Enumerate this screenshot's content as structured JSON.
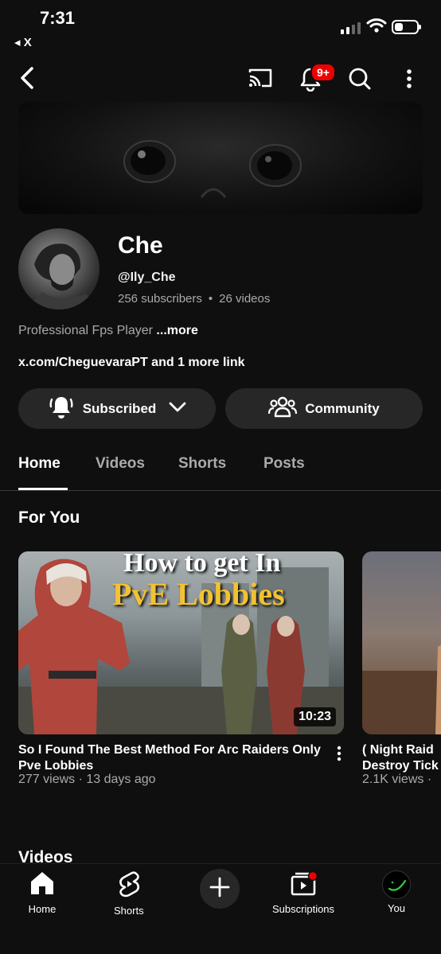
{
  "status": {
    "time": "7:31",
    "back_app": "◂ X"
  },
  "topbar": {
    "notifications_badge": "9+"
  },
  "channel": {
    "name": "Che",
    "handle": "@Ily_Che",
    "subscribers": "256 subscribers",
    "separator": "•",
    "videos": "26 videos",
    "description": "Professional Fps Player",
    "more": "...more",
    "links": "x.com/CheguevaraPT and 1 more link"
  },
  "actions": {
    "subscribed": "Subscribed",
    "community": "Community"
  },
  "tabs": [
    "Home",
    "Videos",
    "Shorts",
    "Posts"
  ],
  "sections": {
    "for_you": "For You",
    "videos": "Videos"
  },
  "videos": [
    {
      "thumb_title_line1": "How to get In",
      "thumb_title_line2": "PvE Lobbies",
      "duration": "10:23",
      "title": "So I Found The Best Method For Arc Raiders Only Pve Lobbies",
      "meta": "277 views · 13 days ago"
    },
    {
      "title": "( Night Raid Destroy Tick",
      "meta": "2.1K views ·"
    }
  ],
  "nav": {
    "home": "Home",
    "shorts": "Shorts",
    "subscriptions": "Subscriptions",
    "you": "You"
  },
  "colors": {
    "background": "#0f0f0f",
    "pill": "#272727",
    "badge": "#e00000",
    "thumb_title_gold": "#f2c232"
  }
}
